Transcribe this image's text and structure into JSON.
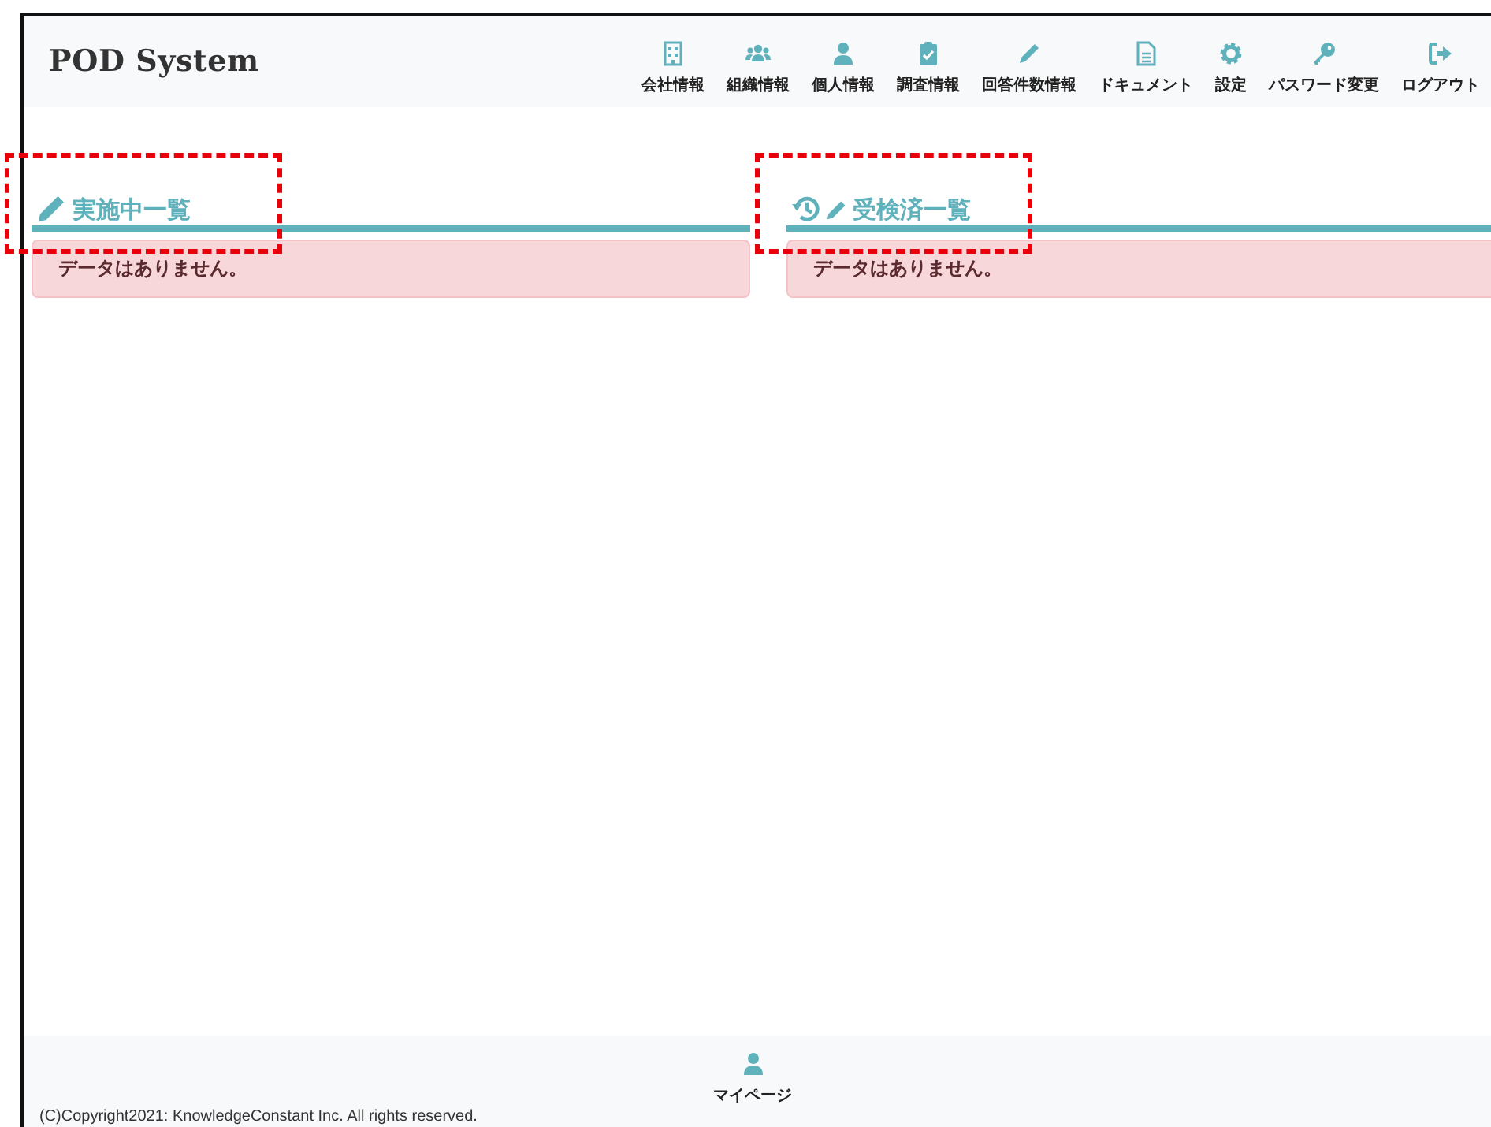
{
  "header": {
    "logo": "POD System",
    "nav": [
      {
        "label": "会社情報"
      },
      {
        "label": "組織情報"
      },
      {
        "label": "個人情報"
      },
      {
        "label": "調査情報"
      },
      {
        "label": "回答件数情報"
      },
      {
        "label": "ドキュメント"
      },
      {
        "label": "設定"
      },
      {
        "label": "パスワード変更"
      },
      {
        "label": "ログアウト"
      }
    ]
  },
  "sections": [
    {
      "title": "実施中一覧",
      "message": "データはありません。"
    },
    {
      "title": "受検済一覧",
      "message": "データはありません。"
    }
  ],
  "footer": {
    "copyright": "(C)Copyright2021: KnowledgeConstant Inc. All rights reserved.",
    "mypage": "マイページ"
  }
}
